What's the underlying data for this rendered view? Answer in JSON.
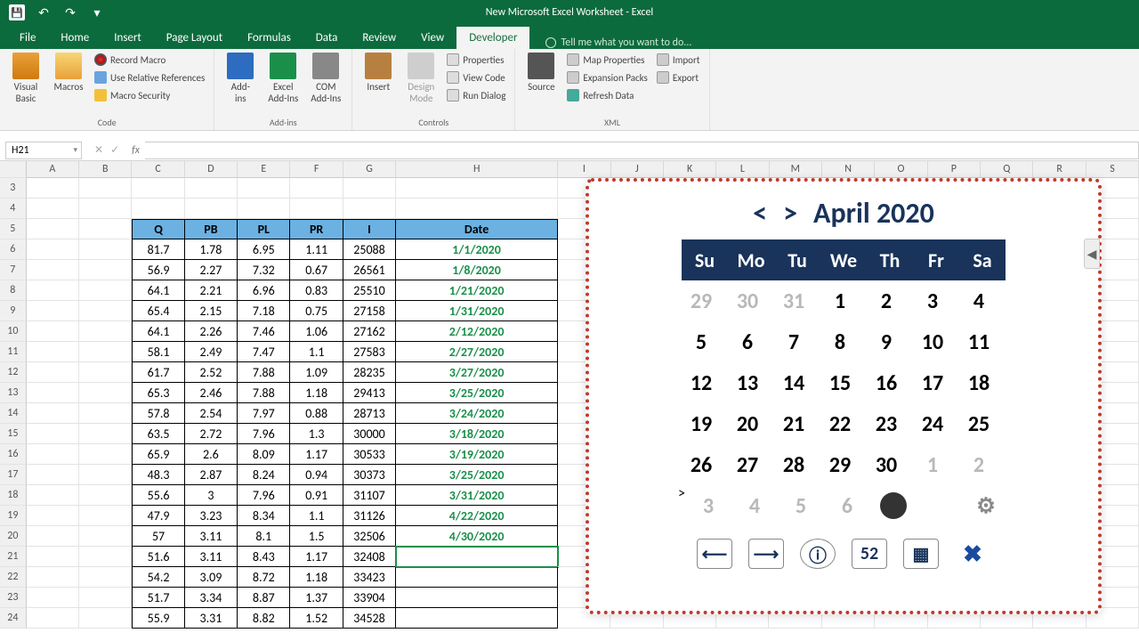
{
  "app": {
    "title": "New Microsoft Excel Worksheet - Excel"
  },
  "qat": {
    "save": "💾",
    "undo": "↶",
    "redo": "↷",
    "more": "▾"
  },
  "tabs": {
    "items": [
      "File",
      "Home",
      "Insert",
      "Page Layout",
      "Formulas",
      "Data",
      "Review",
      "View",
      "Developer"
    ],
    "active": "Developer",
    "tell": "Tell me what you want to do..."
  },
  "ribbon": {
    "code": {
      "visual_basic": "Visual\nBasic",
      "macros": "Macros",
      "record": "Record Macro",
      "relative": "Use Relative References",
      "security": "Macro Security",
      "label": "Code"
    },
    "addins": {
      "addins": "Add-\nins",
      "excel": "Excel\nAdd-Ins",
      "com": "COM\nAdd-Ins",
      "label": "Add-ins"
    },
    "controls": {
      "insert": "Insert",
      "design": "Design\nMode",
      "properties": "Properties",
      "view_code": "View Code",
      "run_dialog": "Run Dialog",
      "label": "Controls"
    },
    "xml": {
      "source": "Source",
      "map": "Map Properties",
      "expansion": "Expansion Packs",
      "refresh": "Refresh Data",
      "import": "Import",
      "export": "Export",
      "label": "XML"
    }
  },
  "namebox": "H21",
  "columns": [
    "A",
    "B",
    "C",
    "D",
    "E",
    "F",
    "G",
    "H",
    "I",
    "J",
    "K",
    "L",
    "M",
    "N",
    "O",
    "P",
    "Q",
    "R",
    "S"
  ],
  "first_row": 3,
  "table": {
    "headers": [
      "Q",
      "PB",
      "PL",
      "PR",
      "I",
      "Date"
    ],
    "rows": [
      {
        "q": "81.7",
        "pb": "1.78",
        "pl": "6.95",
        "pr": "1.11",
        "i": "25088",
        "date": "1/1/2020"
      },
      {
        "q": "56.9",
        "pb": "2.27",
        "pl": "7.32",
        "pr": "0.67",
        "i": "26561",
        "date": "1/8/2020"
      },
      {
        "q": "64.1",
        "pb": "2.21",
        "pl": "6.96",
        "pr": "0.83",
        "i": "25510",
        "date": "1/21/2020"
      },
      {
        "q": "65.4",
        "pb": "2.15",
        "pl": "7.18",
        "pr": "0.75",
        "i": "27158",
        "date": "1/31/2020"
      },
      {
        "q": "64.1",
        "pb": "2.26",
        "pl": "7.46",
        "pr": "1.06",
        "i": "27162",
        "date": "2/12/2020"
      },
      {
        "q": "58.1",
        "pb": "2.49",
        "pl": "7.47",
        "pr": "1.1",
        "i": "27583",
        "date": "2/27/2020"
      },
      {
        "q": "61.7",
        "pb": "2.52",
        "pl": "7.88",
        "pr": "1.09",
        "i": "28235",
        "date": "3/27/2020"
      },
      {
        "q": "65.3",
        "pb": "2.46",
        "pl": "7.88",
        "pr": "1.18",
        "i": "29413",
        "date": "3/25/2020"
      },
      {
        "q": "57.8",
        "pb": "2.54",
        "pl": "7.97",
        "pr": "0.88",
        "i": "28713",
        "date": "3/24/2020"
      },
      {
        "q": "63.5",
        "pb": "2.72",
        "pl": "7.96",
        "pr": "1.3",
        "i": "30000",
        "date": "3/18/2020"
      },
      {
        "q": "65.9",
        "pb": "2.6",
        "pl": "8.09",
        "pr": "1.17",
        "i": "30533",
        "date": "3/19/2020"
      },
      {
        "q": "48.3",
        "pb": "2.87",
        "pl": "8.24",
        "pr": "0.94",
        "i": "30373",
        "date": "3/25/2020"
      },
      {
        "q": "55.6",
        "pb": "3",
        "pl": "7.96",
        "pr": "0.91",
        "i": "31107",
        "date": "3/31/2020"
      },
      {
        "q": "47.9",
        "pb": "3.23",
        "pl": "8.34",
        "pr": "1.1",
        "i": "31126",
        "date": "4/22/2020"
      },
      {
        "q": "57",
        "pb": "3.11",
        "pl": "8.1",
        "pr": "1.5",
        "i": "32506",
        "date": "4/30/2020"
      },
      {
        "q": "51.6",
        "pb": "3.11",
        "pl": "8.43",
        "pr": "1.17",
        "i": "32408",
        "date": ""
      },
      {
        "q": "54.2",
        "pb": "3.09",
        "pl": "8.72",
        "pr": "1.18",
        "i": "33423",
        "date": ""
      },
      {
        "q": "51.7",
        "pb": "3.34",
        "pl": "8.87",
        "pr": "1.37",
        "i": "33904",
        "date": ""
      },
      {
        "q": "55.9",
        "pb": "3.31",
        "pl": "8.82",
        "pr": "1.52",
        "i": "34528",
        "date": ""
      }
    ]
  },
  "calendar": {
    "title": "April 2020",
    "prev": "<",
    "next": ">",
    "dow": [
      "Su",
      "Mo",
      "Tu",
      "We",
      "Th",
      "Fr",
      "Sa"
    ],
    "grid": [
      [
        {
          "d": "29",
          "dim": true
        },
        {
          "d": "30",
          "dim": true
        },
        {
          "d": "31",
          "dim": true
        },
        {
          "d": "1"
        },
        {
          "d": "2"
        },
        {
          "d": "3"
        },
        {
          "d": "4"
        }
      ],
      [
        {
          "d": "5"
        },
        {
          "d": "6"
        },
        {
          "d": "7"
        },
        {
          "d": "8"
        },
        {
          "d": "9"
        },
        {
          "d": "10"
        },
        {
          "d": "11"
        }
      ],
      [
        {
          "d": "12"
        },
        {
          "d": "13"
        },
        {
          "d": "14"
        },
        {
          "d": "15"
        },
        {
          "d": "16"
        },
        {
          "d": "17"
        },
        {
          "d": "18"
        }
      ],
      [
        {
          "d": "19"
        },
        {
          "d": "20"
        },
        {
          "d": "21"
        },
        {
          "d": "22"
        },
        {
          "d": "23"
        },
        {
          "d": "24"
        },
        {
          "d": "25"
        }
      ],
      [
        {
          "d": "26"
        },
        {
          "d": "27"
        },
        {
          "d": "28"
        },
        {
          "d": "29"
        },
        {
          "d": "30"
        },
        {
          "d": "1",
          "dim": true
        },
        {
          "d": "2",
          "dim": true
        }
      ],
      [
        {
          "d": "3",
          "dim": true
        },
        {
          "d": "4",
          "dim": true
        },
        {
          "d": "5",
          "dim": true
        },
        {
          "d": "6",
          "dim": true
        },
        {
          "d": "",
          "today": true
        },
        {
          "d": "",
          "blank": true
        },
        {
          "d": "⚙",
          "gear": true
        }
      ]
    ],
    "tools": [
      "⟵",
      "⟶",
      "ⓘ",
      "52",
      "▦",
      "✖"
    ]
  }
}
